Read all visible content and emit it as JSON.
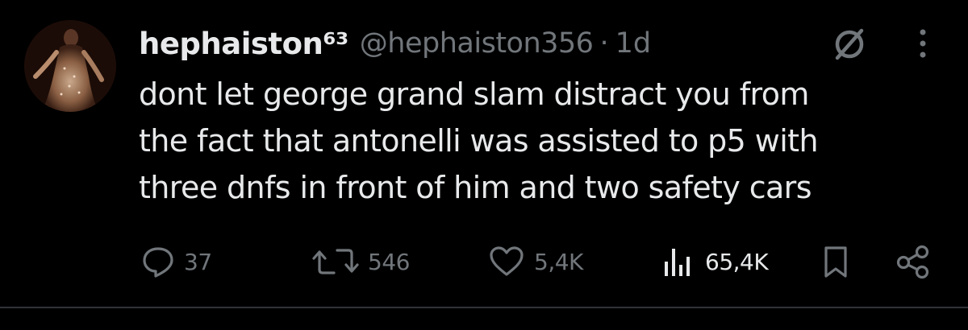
{
  "tweet": {
    "display_name": "hephaiston⁶³",
    "handle": "@hephaiston356",
    "separator": "·",
    "time": "1d",
    "text_lines": [
      "dont let george grand slam distract you from",
      "the fact that antonelli was assisted to p5 with",
      "three dnfs in front of him and two safety cars"
    ]
  },
  "actions": {
    "replies": "37",
    "reposts": "546",
    "likes": "5,4K",
    "views": "65,4K"
  },
  "icons": {
    "reply": "reply-icon",
    "repost": "repost-icon",
    "like": "heart-icon",
    "views": "analytics-icon",
    "bookmark": "bookmark-icon",
    "share": "share-icon",
    "grok": "grok-icon",
    "more": "more-icon"
  },
  "colors": {
    "background": "#000000",
    "primary_text": "#e7e9ea",
    "secondary_text": "#71767b",
    "divider": "#2f3336"
  }
}
